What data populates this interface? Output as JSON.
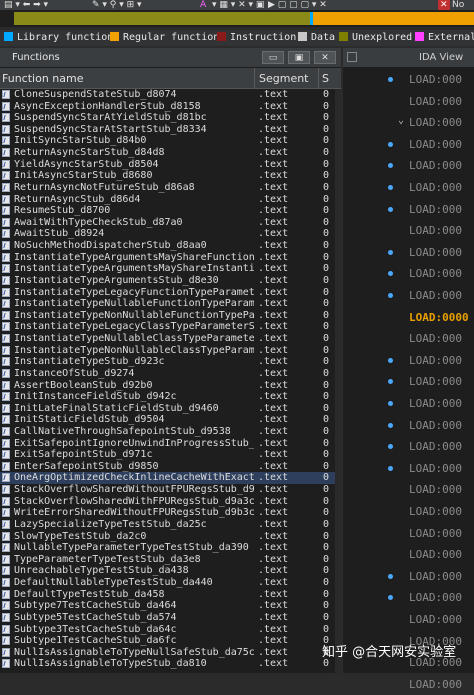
{
  "toolbar": {
    "partial_label": "No"
  },
  "legend": [
    {
      "label": "Library function",
      "color": "#00aaff"
    },
    {
      "label": "Regular function",
      "color": "#f0a000"
    },
    {
      "label": "Instruction",
      "color": "#8b1a1a"
    },
    {
      "label": "Data",
      "color": "#c8c8c8"
    },
    {
      "label": "Unexplored",
      "color": "#808000"
    },
    {
      "label": "External",
      "color": "#ff40ff"
    }
  ],
  "functions_window": {
    "title": "Functions",
    "col_name": "Function name",
    "col_segment": "Segment",
    "col_start": "S",
    "rows": [
      {
        "name": "CloneSuspendStateStub_d8074",
        "segment": ".text",
        "start": "0"
      },
      {
        "name": "AsyncExceptionHandlerStub_d8158",
        "segment": ".text",
        "start": "0"
      },
      {
        "name": "SuspendSyncStarAtYieldStub_d81bc",
        "segment": ".text",
        "start": "0"
      },
      {
        "name": "SuspendSyncStarAtStartStub_d8334",
        "segment": ".text",
        "start": "0"
      },
      {
        "name": "InitSyncStarStub_d84b0",
        "segment": ".text",
        "start": "0"
      },
      {
        "name": "ReturnAsyncStarStub_d84d8",
        "segment": ".text",
        "start": "0"
      },
      {
        "name": "YieldAsyncStarStub_d8504",
        "segment": ".text",
        "start": "0"
      },
      {
        "name": "InitAsyncStarStub_d8680",
        "segment": ".text",
        "start": "0"
      },
      {
        "name": "ReturnAsyncNotFutureStub_d86a8",
        "segment": ".text",
        "start": "0"
      },
      {
        "name": "ReturnAsyncStub_d86d4",
        "segment": ".text",
        "start": "0"
      },
      {
        "name": "ResumeStub_d8700",
        "segment": ".text",
        "start": "0"
      },
      {
        "name": "AwaitWithTypeCheckStub_d87a0",
        "segment": ".text",
        "start": "0"
      },
      {
        "name": "AwaitStub_d8924",
        "segment": ".text",
        "start": "0"
      },
      {
        "name": "NoSuchMethodDispatcherStub_d8aa0",
        "segment": ".text",
        "start": "0"
      },
      {
        "name": "InstantiateTypeArgumentsMayShareFunctionT…",
        "segment": ".text",
        "start": "0"
      },
      {
        "name": "InstantiateTypeArgumentsMayShareInstantia…",
        "segment": ".text",
        "start": "0"
      },
      {
        "name": "InstantiateTypeArgumentsStub_d8e30",
        "segment": ".text",
        "start": "0"
      },
      {
        "name": "InstantiateTypeLegacyFunctionTypeParamete…",
        "segment": ".text",
        "start": "0"
      },
      {
        "name": "InstantiateTypeNullableFunctionTypeParame…",
        "segment": ".text",
        "start": "0"
      },
      {
        "name": "InstantiateTypeNonNullableFunctionTypePar…",
        "segment": ".text",
        "start": "0"
      },
      {
        "name": "InstantiateTypeLegacyClassTypeParameterSt…",
        "segment": ".text",
        "start": "0"
      },
      {
        "name": "InstantiateTypeNullableClassTypeParameter…",
        "segment": ".text",
        "start": "0"
      },
      {
        "name": "InstantiateTypeNonNullableClassTypeParame…",
        "segment": ".text",
        "start": "0"
      },
      {
        "name": "InstantiateTypeStub_d923c",
        "segment": ".text",
        "start": "0"
      },
      {
        "name": "InstanceOfStub_d9274",
        "segment": ".text",
        "start": "0"
      },
      {
        "name": "AssertBooleanStub_d92b0",
        "segment": ".text",
        "start": "0"
      },
      {
        "name": "InitInstanceFieldStub_d942c",
        "segment": ".text",
        "start": "0"
      },
      {
        "name": "InitLateFinalStaticFieldStub_d9460",
        "segment": ".text",
        "start": "0"
      },
      {
        "name": "InitStaticFieldStub_d9504",
        "segment": ".text",
        "start": "0"
      },
      {
        "name": "CallNativeThroughSafepointStub_d9538",
        "segment": ".text",
        "start": "0"
      },
      {
        "name": "ExitSafepointIgnoreUnwindInProgressStub_d…",
        "segment": ".text",
        "start": "0"
      },
      {
        "name": "ExitSafepointStub_d971c",
        "segment": ".text",
        "start": "0"
      },
      {
        "name": "EnterSafepointStub_d9850",
        "segment": ".text",
        "start": "0"
      },
      {
        "name": "OneArgOptimizedCheckInlineCacheWithExactn…",
        "segment": ".text",
        "start": "0"
      },
      {
        "name": "StackOverflowSharedWithoutFPURegsStub_d99bc",
        "segment": ".text",
        "start": "0"
      },
      {
        "name": "StackOverflowSharedWithFPURegsStub_d9a3c",
        "segment": ".text",
        "start": "0"
      },
      {
        "name": "WriteErrorSharedWithoutFPURegsStub_d9b3c",
        "segment": ".text",
        "start": "0"
      },
      {
        "name": "LazySpecializeTypeTestStub_da25c",
        "segment": ".text",
        "start": "0"
      },
      {
        "name": "SlowTypeTestStub_da2c0",
        "segment": ".text",
        "start": "0"
      },
      {
        "name": "NullableTypeParameterTypeTestStub_da390",
        "segment": ".text",
        "start": "0"
      },
      {
        "name": "TypeParameterTypeTestStub_da3e8",
        "segment": ".text",
        "start": "0"
      },
      {
        "name": "UnreachableTypeTestStub_da438",
        "segment": ".text",
        "start": "0"
      },
      {
        "name": "DefaultNullableTypeTestStub_da440",
        "segment": ".text",
        "start": "0"
      },
      {
        "name": "DefaultTypeTestStub_da458",
        "segment": ".text",
        "start": "0"
      },
      {
        "name": "Subtype7TestCacheStub_da464",
        "segment": ".text",
        "start": "0"
      },
      {
        "name": "Subtype5TestCacheStub_da574",
        "segment": ".text",
        "start": "0"
      },
      {
        "name": "Subtype3TestCacheStub_da64c",
        "segment": ".text",
        "start": "0"
      },
      {
        "name": "Subtype1TestCacheStub_da6fc",
        "segment": ".text",
        "start": "0"
      },
      {
        "name": "NullIsAssignableToTypeNullSafeStub_da75c",
        "segment": ".text",
        "start": "0"
      },
      {
        "name": "NullIsAssignableToTypeStub_da810",
        "segment": ".text",
        "start": "0"
      }
    ]
  },
  "ida_view": {
    "title": "IDA View",
    "lines": [
      {
        "text": "LOAD:000",
        "dot": true,
        "highlight": false
      },
      {
        "text": "LOAD:000",
        "dot": false,
        "highlight": false
      },
      {
        "text": "LOAD:000",
        "dot": false,
        "highlight": false,
        "arrow": true
      },
      {
        "text": "LOAD:000",
        "dot": true,
        "highlight": false
      },
      {
        "text": "LOAD:000",
        "dot": true,
        "highlight": false
      },
      {
        "text": "LOAD:000",
        "dot": true,
        "highlight": false
      },
      {
        "text": "LOAD:000",
        "dot": true,
        "highlight": false
      },
      {
        "text": "LOAD:000",
        "dot": false,
        "highlight": false
      },
      {
        "text": "LOAD:000",
        "dot": true,
        "highlight": false
      },
      {
        "text": "LOAD:000",
        "dot": true,
        "highlight": false
      },
      {
        "text": "LOAD:000",
        "dot": true,
        "highlight": false
      },
      {
        "text": "LOAD:0000",
        "dot": false,
        "highlight": true
      },
      {
        "text": "LOAD:000",
        "dot": false,
        "highlight": false
      },
      {
        "text": "LOAD:000",
        "dot": true,
        "highlight": false
      },
      {
        "text": "LOAD:000",
        "dot": true,
        "highlight": false
      },
      {
        "text": "LOAD:000",
        "dot": true,
        "highlight": false
      },
      {
        "text": "LOAD:000",
        "dot": true,
        "highlight": false
      },
      {
        "text": "LOAD:000",
        "dot": true,
        "highlight": false
      },
      {
        "text": "LOAD:000",
        "dot": true,
        "highlight": false
      },
      {
        "text": "LOAD:000",
        "dot": false,
        "highlight": false
      },
      {
        "text": "LOAD:000",
        "dot": false,
        "highlight": false
      },
      {
        "text": "LOAD:000",
        "dot": false,
        "highlight": false
      },
      {
        "text": "LOAD:000",
        "dot": false,
        "highlight": false
      },
      {
        "text": "LOAD:000",
        "dot": true,
        "highlight": false
      },
      {
        "text": "LOAD:000",
        "dot": true,
        "highlight": false
      },
      {
        "text": "LOAD:000",
        "dot": false,
        "highlight": false
      },
      {
        "text": "LOAD:000",
        "dot": false,
        "highlight": false
      },
      {
        "text": "LOAD:000",
        "dot": false,
        "highlight": false
      },
      {
        "text": "LOAD:000",
        "dot": false,
        "highlight": false
      }
    ]
  },
  "watermark": "知乎 @合天网安实验室"
}
